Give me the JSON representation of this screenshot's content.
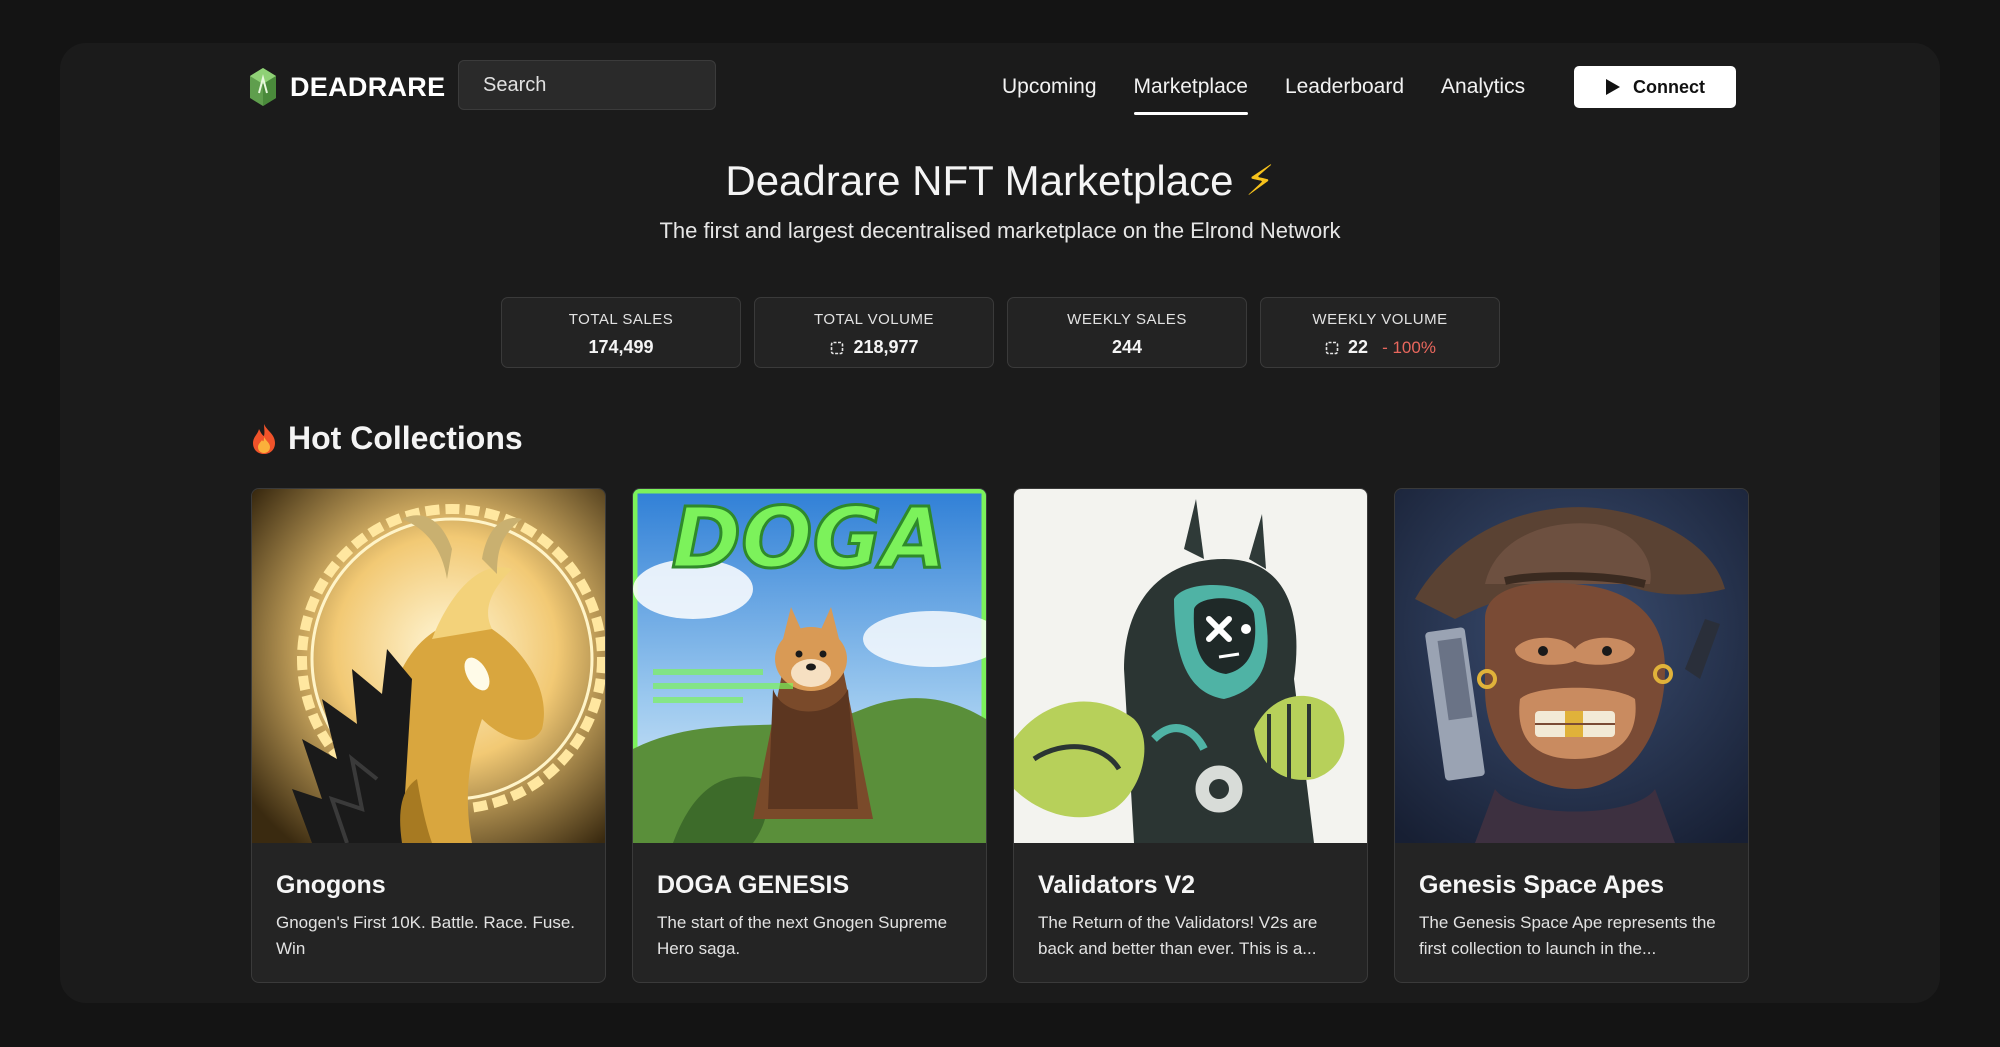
{
  "colors": {
    "background": "#141414",
    "panel": "#1b1b1b",
    "accent_green": "#6fbf5a",
    "negative": "#e8675d",
    "bolt": "#f6c21c"
  },
  "header": {
    "logo_icon": "deadrare-gem-icon",
    "logo_text": "DEADRARE",
    "search_placeholder": "Search",
    "nav": [
      {
        "label": "Upcoming",
        "active": false
      },
      {
        "label": "Marketplace",
        "active": true
      },
      {
        "label": "Leaderboard",
        "active": false
      },
      {
        "label": "Analytics",
        "active": false
      }
    ],
    "connect_icon": "play-icon",
    "connect_label": "Connect"
  },
  "hero": {
    "title": "Deadrare NFT Marketplace",
    "title_icon": "lightning-bolt-icon",
    "subtitle": "The first and largest decentralised marketplace on the Elrond Network"
  },
  "stats": [
    {
      "label": "TOTAL SALES",
      "value": "174,499",
      "currency_icon": false
    },
    {
      "label": "TOTAL VOLUME",
      "value": "218,977",
      "currency_icon": true
    },
    {
      "label": "WEEKLY SALES",
      "value": "244",
      "currency_icon": false
    },
    {
      "label": "WEEKLY VOLUME",
      "value": "22",
      "currency_icon": true,
      "change": "- 100%"
    }
  ],
  "hot_collections": {
    "title": "Hot Collections",
    "icon": "fire-icon",
    "items": [
      {
        "name": "Gnogons",
        "description": "Gnogen's First 10K. Battle. Race. Fuse. Win",
        "image": "golden-dragon-artwork"
      },
      {
        "name": "DOGA GENESIS",
        "description": "The start of the next Gnogen Supreme Hero saga.",
        "image": "doga-shiba-artwork",
        "image_text": "DOGA"
      },
      {
        "name": "Validators V2",
        "description": "The Return of the Validators! V2s are back and better than ever. This is a...",
        "image": "robot-knight-artwork"
      },
      {
        "name": "Genesis Space Apes",
        "description": "The Genesis Space Ape represents the first collection to launch in the...",
        "image": "cowboy-ape-artwork"
      }
    ]
  }
}
